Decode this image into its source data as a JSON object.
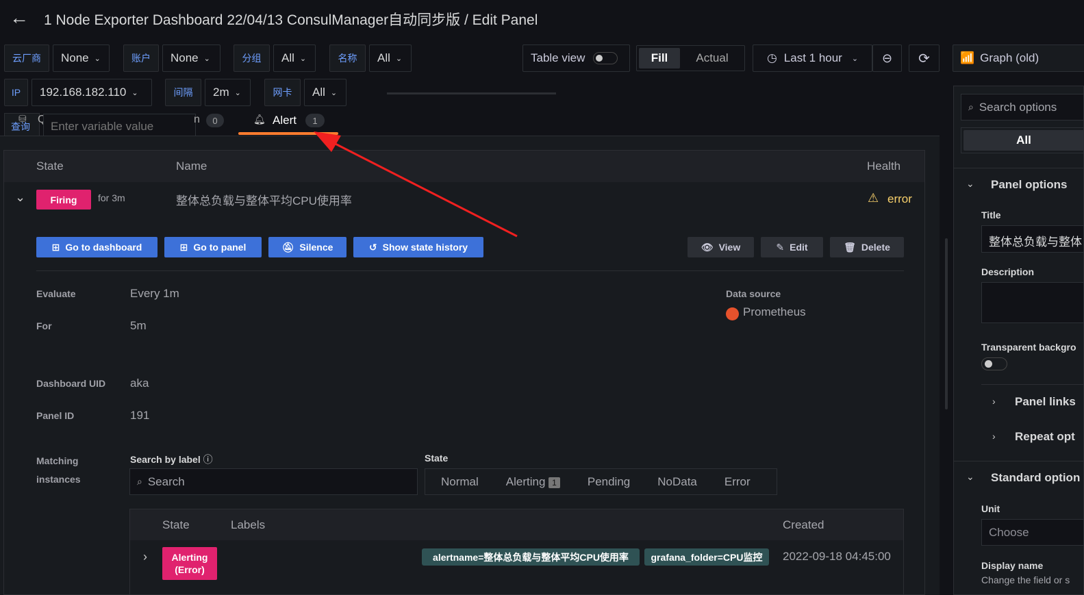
{
  "header": {
    "title": "1 Node Exporter Dashboard 22/04/13 ConsulManager自动同步版 / Edit Panel"
  },
  "variables": [
    {
      "label": "云厂商",
      "value": "None"
    },
    {
      "label": "账户",
      "value": "None"
    },
    {
      "label": "分组",
      "value": "All"
    },
    {
      "label": "名称",
      "value": "All"
    },
    {
      "label": "IP",
      "value": "192.168.182.110"
    },
    {
      "label": "间隔",
      "value": "2m"
    },
    {
      "label": "网卡",
      "value": "All"
    },
    {
      "label": "查询",
      "value": ""
    }
  ],
  "variable_input": {
    "placeholder": "Enter variable value"
  },
  "toolbar": {
    "table_view": "Table view",
    "fill": "Fill",
    "actual": "Actual",
    "time_range": "Last 1 hour",
    "visualization": "Graph (old)"
  },
  "tabs": [
    {
      "label": "Q",
      "count": ""
    },
    {
      "label": "n",
      "count": "0"
    },
    {
      "label": "Alert",
      "count": "1"
    }
  ],
  "rule_table": {
    "headers": [
      "State",
      "Name",
      "Health"
    ],
    "state": "Firing",
    "for": "for 3m",
    "name": "整体总负载与整体平均CPU使用率",
    "health": "error"
  },
  "actions": {
    "go_dashboard": "Go to dashboard",
    "go_panel": "Go to panel",
    "silence": "Silence",
    "history": "Show state history",
    "view": "View",
    "edit": "Edit",
    "delete": "Delete"
  },
  "details": {
    "evaluate_label": "Evaluate",
    "evaluate": "Every 1m",
    "for_label": "For",
    "for": "5m",
    "uid_label": "Dashboard UID",
    "uid": "aka",
    "panel_label": "Panel ID",
    "panel": "191",
    "ds_label": "Data source",
    "ds": "Prometheus"
  },
  "matching": {
    "label_line1": "Matching",
    "label_line2": "instances",
    "search_label": "Search by label",
    "search_placeholder": "Search",
    "state_label": "State",
    "states": [
      "Normal",
      "Alerting",
      "Pending",
      "NoData",
      "Error"
    ],
    "alerting_count": "1",
    "headers": [
      "State",
      "Labels",
      "Created"
    ],
    "row": {
      "state_line1": "Alerting",
      "state_line2": "(Error)",
      "labels": [
        "alertname=整体总负载与整体平均CPU使用率",
        "grafana_folder=CPU监控"
      ],
      "created": "2022-09-18 04:45:00"
    }
  },
  "sidebar": {
    "search_placeholder": "Search options",
    "all": "All",
    "panel_options": "Panel options",
    "title_label": "Title",
    "title_value": "整体总负载与整体",
    "description": "Description",
    "transparent": "Transparent backgro",
    "panel_links": "Panel links",
    "repeat": "Repeat opt",
    "standard": "Standard option",
    "unit": "Unit",
    "unit_placeholder": "Choose",
    "display_name": "Display name",
    "display_help": "Change the field or s"
  },
  "colors": {
    "firing": "#e0226e",
    "accent": "#3d71d9",
    "warning": "#f8d06b",
    "tab_underline": "#ff7d2f"
  }
}
